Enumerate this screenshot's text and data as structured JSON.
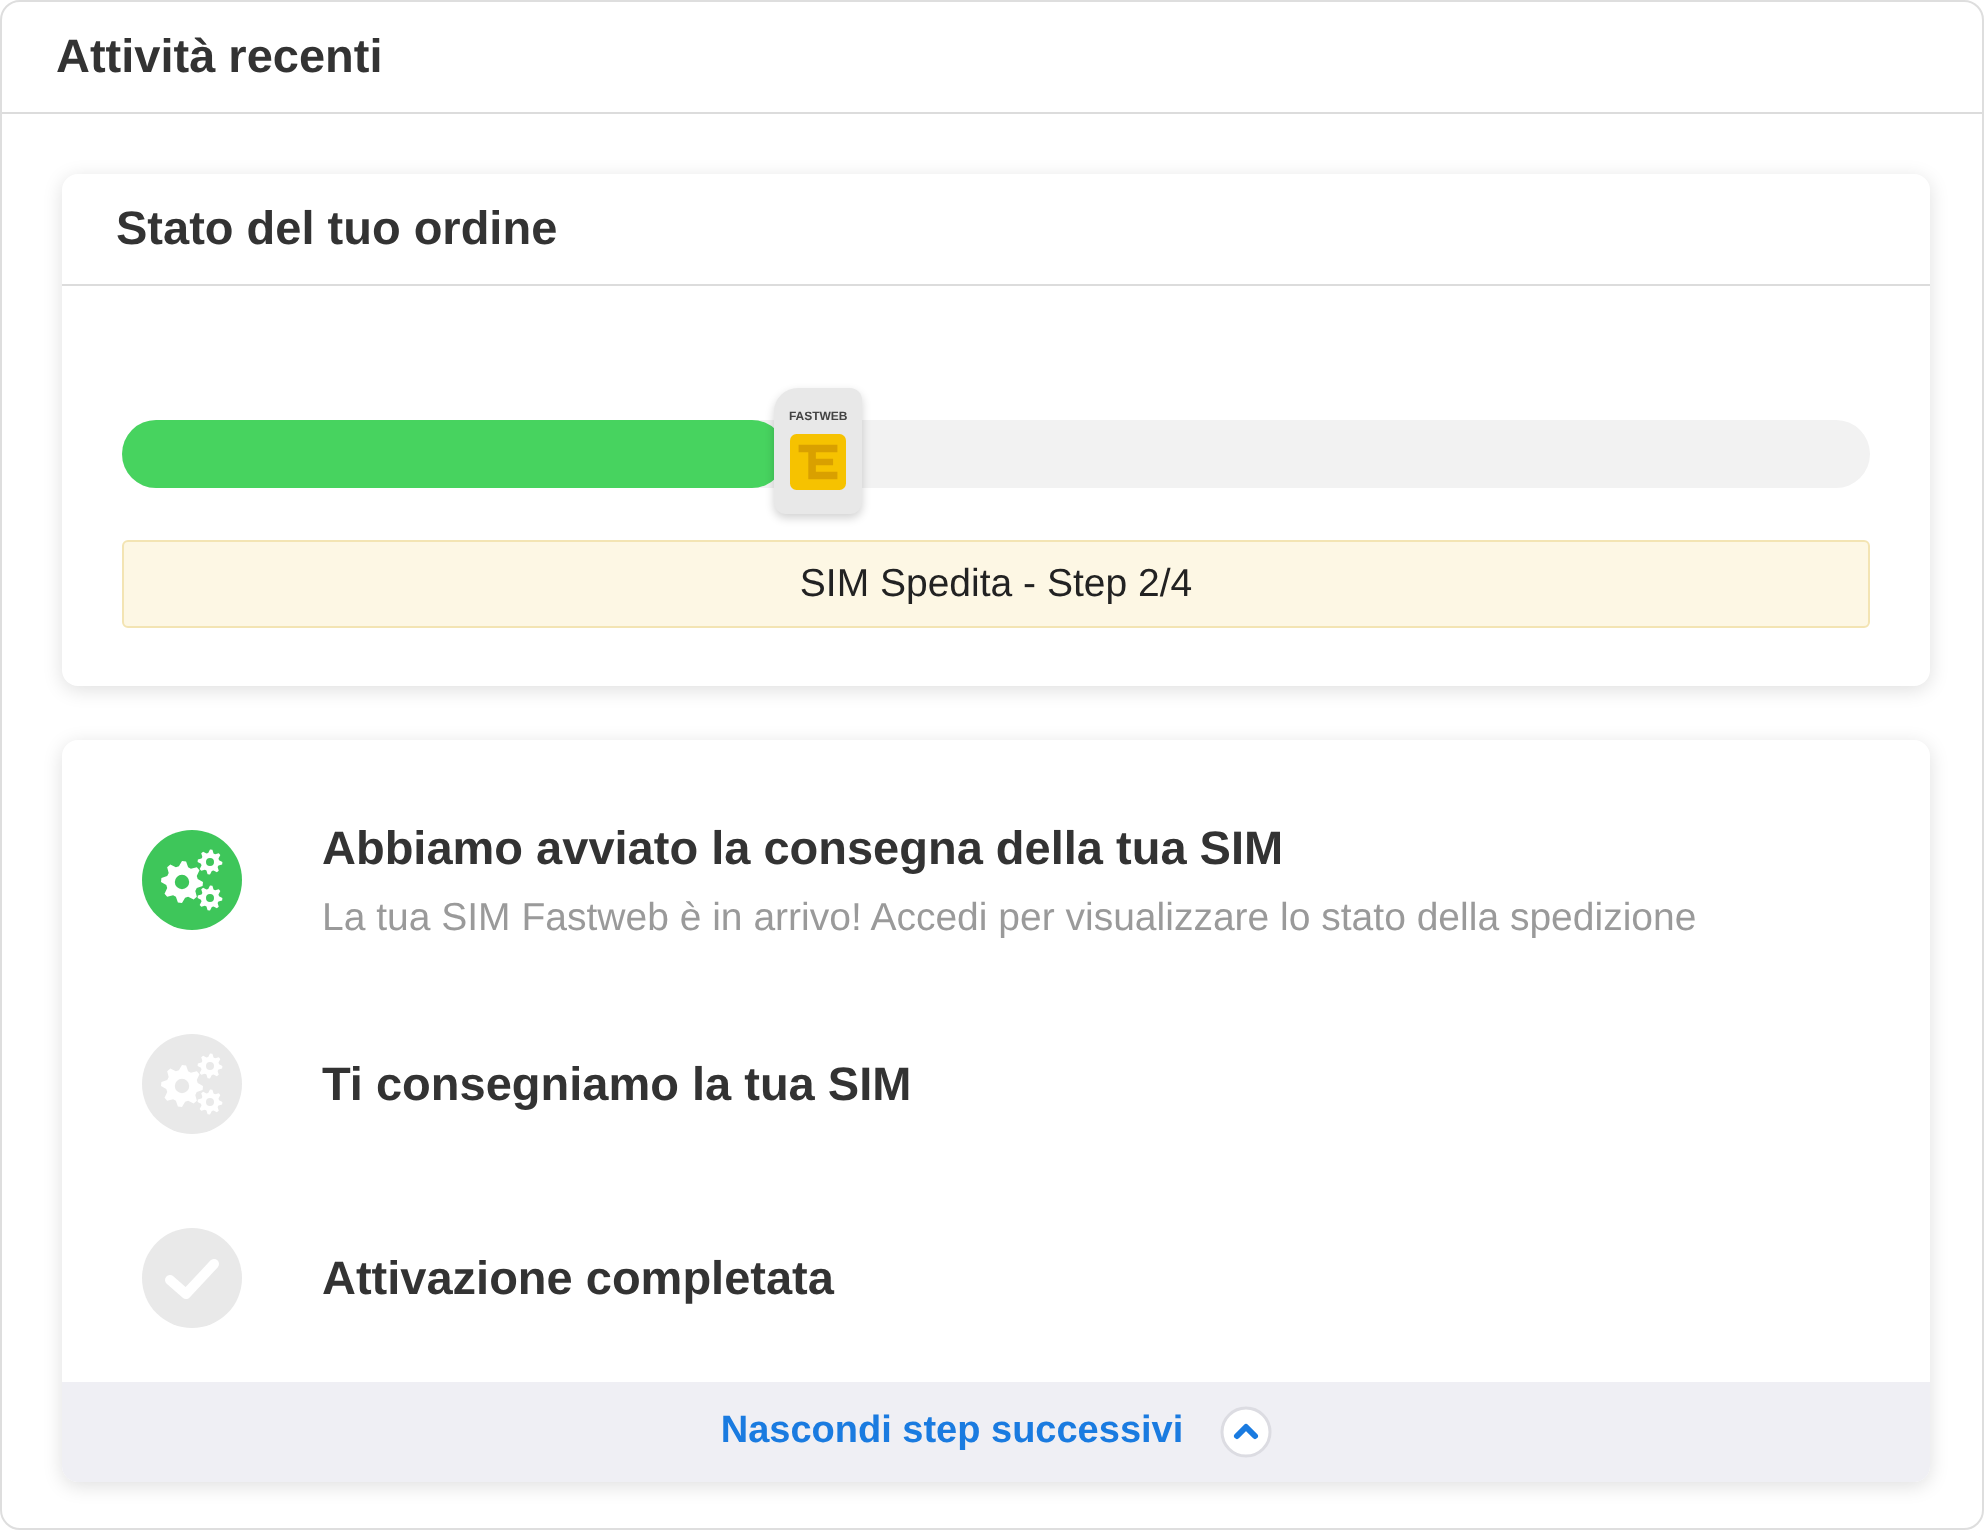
{
  "panel": {
    "title": "Attività recenti"
  },
  "order_card": {
    "title": "Stato del tuo ordine",
    "progress": {
      "level": 0.38,
      "sim_label": "FASTWEB"
    },
    "status": "SIM Spedita - Step 2/4"
  },
  "steps_card": {
    "steps": [
      {
        "kind": "gears",
        "completed": true,
        "title": "Abbiamo avviato la consegna della tua SIM",
        "description": "La tua SIM Fastweb è in arrivo! Accedi per visualizzare lo stato della spedizione"
      },
      {
        "kind": "gears",
        "completed": false,
        "title": "Ti consegniamo la tua SIM"
      },
      {
        "kind": "check",
        "completed": false,
        "title": "Attivazione completata"
      }
    ],
    "toggle": {
      "label": "Nascondi step successivi",
      "expanded": true
    }
  }
}
